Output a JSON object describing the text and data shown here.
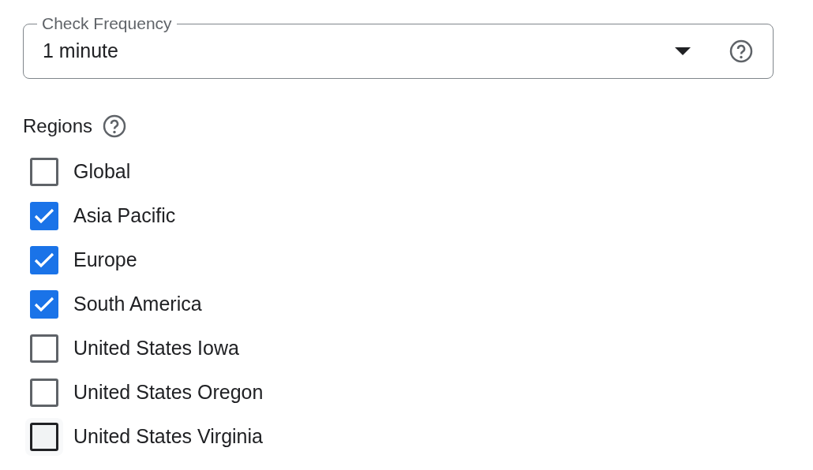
{
  "check_frequency": {
    "label": "Check Frequency",
    "value": "1 minute"
  },
  "regions": {
    "title": "Regions",
    "items": [
      {
        "label": "Global",
        "checked": false,
        "hovered": false
      },
      {
        "label": "Asia Pacific",
        "checked": true,
        "hovered": false
      },
      {
        "label": "Europe",
        "checked": true,
        "hovered": false
      },
      {
        "label": "South America",
        "checked": true,
        "hovered": false
      },
      {
        "label": "United States Iowa",
        "checked": false,
        "hovered": false
      },
      {
        "label": "United States Oregon",
        "checked": false,
        "hovered": false
      },
      {
        "label": "United States Virginia",
        "checked": false,
        "hovered": true
      }
    ]
  }
}
